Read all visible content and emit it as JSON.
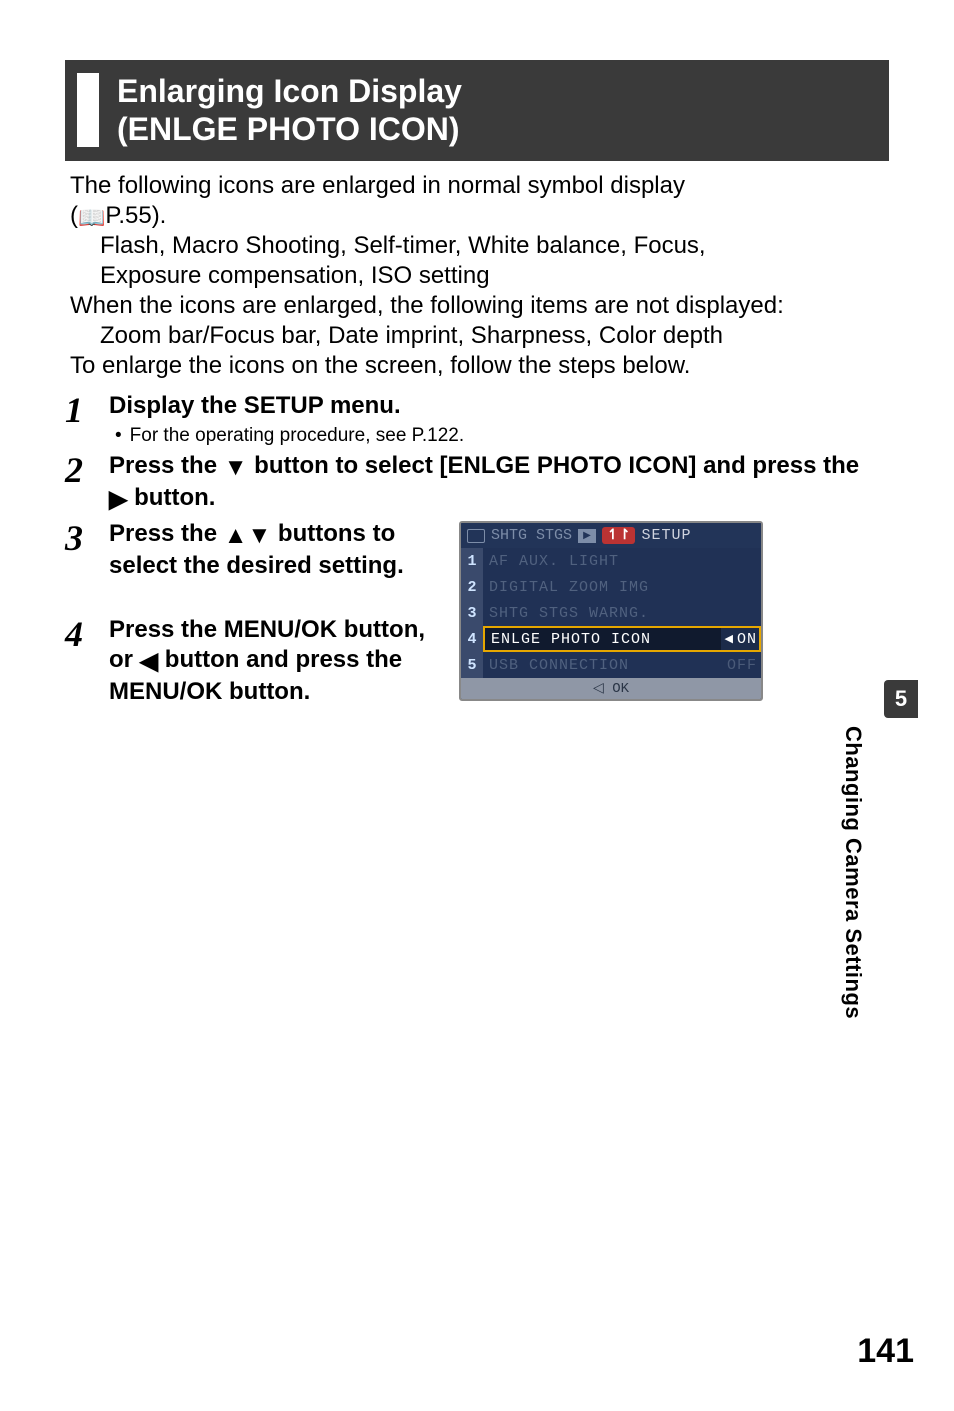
{
  "header": {
    "title_line1": "Enlarging Icon Display",
    "title_line2": "(ENLGE PHOTO ICON)"
  },
  "intro": {
    "line1": "The following icons are enlarged in normal symbol display",
    "ref_open": "(",
    "ref_page": "P.55",
    "ref_close": ").",
    "icons_line1": "Flash, Macro Shooting, Self-timer, White balance, Focus,",
    "icons_line2": "Exposure compensation, ISO setting",
    "line2": "When the icons are enlarged, the following items are not displayed:",
    "hidden_line": "Zoom bar/Focus bar, Date imprint, Sharpness, Color depth",
    "line3": "To enlarge the icons on the screen, follow the steps below."
  },
  "steps": {
    "s1_num": "1",
    "s1_title": "Display the SETUP menu.",
    "s1_note": "For the operating procedure, see P.122.",
    "s2_num": "2",
    "s2_pre": "Press the ",
    "s2_mid": " button to select [ENLGE PHOTO ICON] and press the ",
    "s2_post": " button.",
    "s3_num": "3",
    "s3_pre": "Press the ",
    "s3_post": " buttons to select the desired setting.",
    "s4_num": "4",
    "s4_pre": "Press the MENU/OK button, or ",
    "s4_post": " button and press the MENU/OK button."
  },
  "screenshot": {
    "tab1": "SHTG STGS",
    "setup": "SETUP",
    "rows": [
      {
        "idx": "1",
        "label": "AF AUX. LIGHT"
      },
      {
        "idx": "2",
        "label": "DIGITAL ZOOM IMG"
      },
      {
        "idx": "3",
        "label": "SHTG STGS WARNG."
      },
      {
        "idx": "4",
        "label": "ENLGE PHOTO ICON",
        "val": "ON",
        "sel": true
      },
      {
        "idx": "5",
        "label": "USB CONNECTION",
        "off": "OFF"
      }
    ],
    "footer_left": "◁",
    "footer_ok": "OK"
  },
  "sidetab": {
    "num": "5",
    "text": "Changing Camera Settings"
  },
  "page_number": "141"
}
